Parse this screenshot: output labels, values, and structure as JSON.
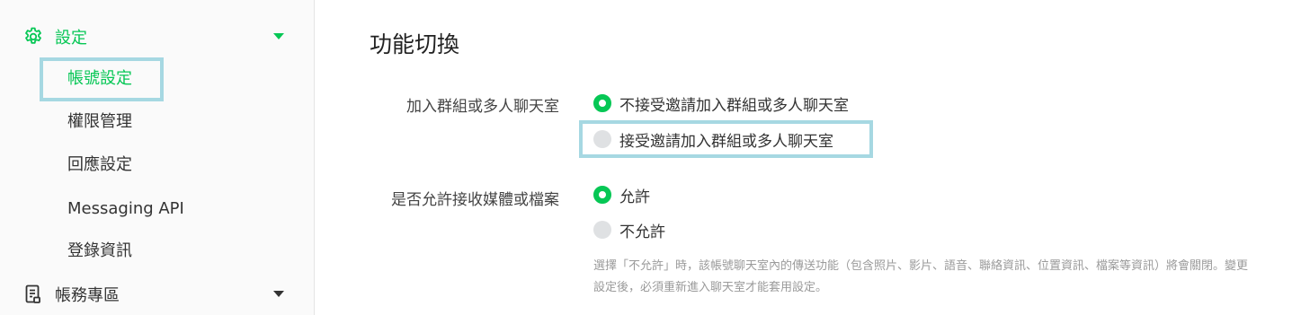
{
  "sidebar": {
    "settings": {
      "label": "設定",
      "icon": "gear-icon"
    },
    "items": [
      {
        "label": "帳號設定",
        "active": true
      },
      {
        "label": "權限管理"
      },
      {
        "label": "回應設定"
      },
      {
        "label": "Messaging API"
      },
      {
        "label": "登錄資訊"
      }
    ],
    "account": {
      "label": "帳務專區",
      "icon": "document-icon"
    }
  },
  "main": {
    "title": "功能切換",
    "groups": [
      {
        "label": "加入群組或多人聊天室",
        "options": [
          {
            "label": "不接受邀請加入群組或多人聊天室",
            "selected": true
          },
          {
            "label": "接受邀請加入群組或多人聊天室",
            "selected": false
          }
        ]
      },
      {
        "label": "是否允許接收媒體或檔案",
        "options": [
          {
            "label": "允許",
            "selected": true
          },
          {
            "label": "不允許",
            "selected": false
          }
        ],
        "note": "選擇「不允許」時，該帳號聊天室內的傳送功能（包含照片、影片、語音、聯絡資訊、位置資訊、檔案等資訊）將會關閉。變更設定後，必須重新進入聊天室才能套用設定。"
      }
    ]
  },
  "colors": {
    "accent": "#06c755",
    "highlight": "#a6d8e2"
  }
}
